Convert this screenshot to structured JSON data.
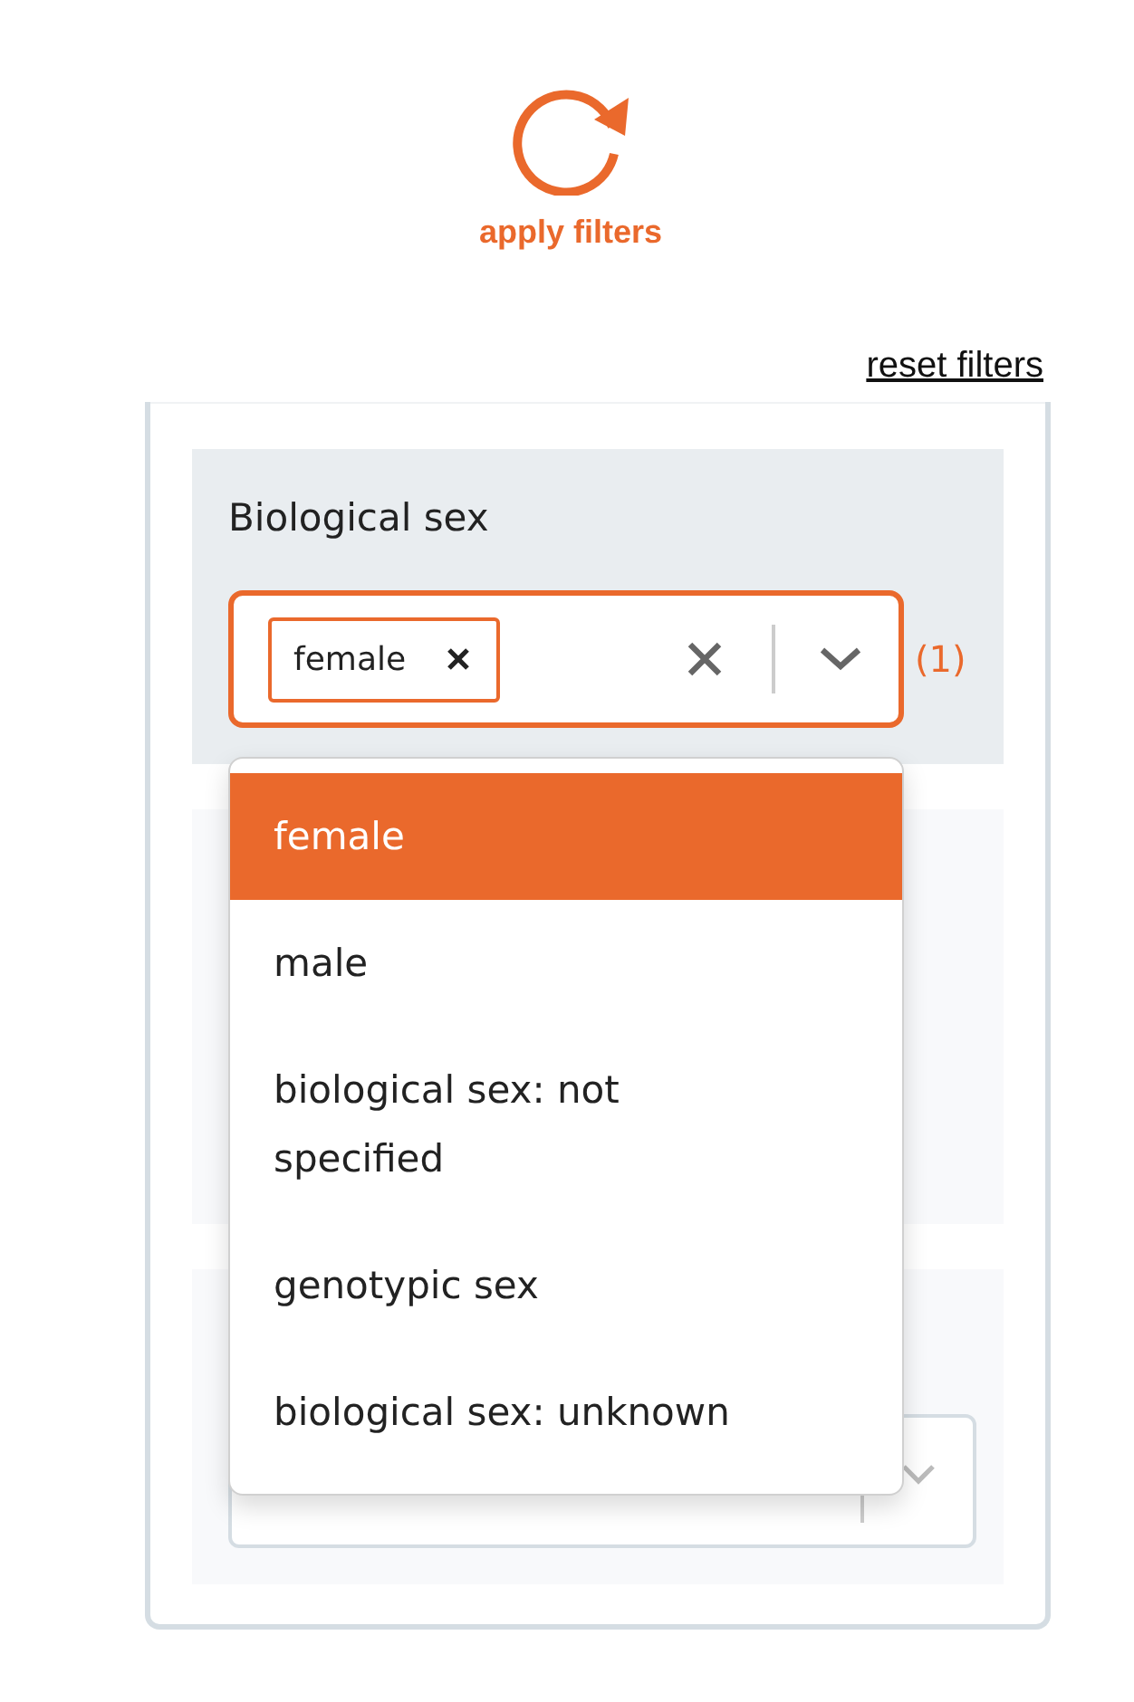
{
  "apply_button": {
    "label": "apply filters"
  },
  "reset_link": {
    "label": "reset filters"
  },
  "filter": {
    "label": "Biological sex",
    "tags": [
      {
        "label": "female"
      }
    ],
    "count": "(1)",
    "options": [
      {
        "label": "female",
        "selected": true
      },
      {
        "label": "male",
        "selected": false
      },
      {
        "label": "biological sex: not specified",
        "selected": false
      },
      {
        "label": "genotypic sex",
        "selected": false
      },
      {
        "label": "biological sex: unknown",
        "selected": false
      }
    ]
  }
}
